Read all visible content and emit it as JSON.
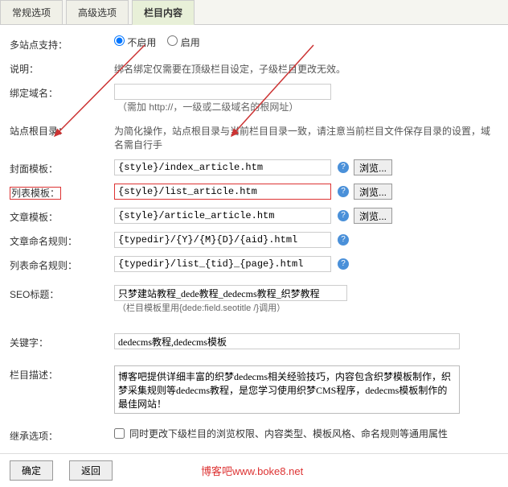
{
  "tabs": {
    "t1": "常规选项",
    "t2": "高级选项",
    "t3": "栏目内容"
  },
  "multisite": {
    "label": "多站点支持：",
    "off": "不启用",
    "on": "启用"
  },
  "explain": {
    "label": "说明：",
    "text": "绑名绑定仅需要在顶级栏目设定，子级栏目更改无效。"
  },
  "binddomain": {
    "label": "绑定域名：",
    "hint": "（需加 http://，一级或二级域名的根网址）"
  },
  "siteroot": {
    "label": "站点根目录：",
    "text": "为简化操作，站点根目录与当前栏目目录一致，请注意当前栏目文件保存目录的设置，域名需自行手"
  },
  "cover": {
    "label": "封面模板：",
    "value": "{style}/index_article.htm",
    "btn": "浏览..."
  },
  "list": {
    "label": "列表模板：",
    "value": "{style}/list_article.htm",
    "btn": "浏览..."
  },
  "article": {
    "label": "文章模板：",
    "value": "{style}/article_article.htm",
    "btn": "浏览..."
  },
  "artrule": {
    "label": "文章命名规则：",
    "value": "{typedir}/{Y}/{M}{D}/{aid}.html"
  },
  "listrule": {
    "label": "列表命名规则：",
    "value": "{typedir}/list_{tid}_{page}.html"
  },
  "seo": {
    "label": "SEO标题：",
    "value": "只梦建站教程_dede教程_dedecms教程_织梦教程",
    "hint": "（栏目模板里用{dede:field.seotitle /}调用）"
  },
  "keywords": {
    "label": "关键字：",
    "value": "dedecms教程,dedecms模板"
  },
  "desc": {
    "label": "栏目描述：",
    "value": "博客吧提供详细丰富的织梦dedecms相关经验技巧，内容包含织梦模板制作，织梦采集规则等dedecms教程，是您学习使用织梦CMS程序，dedecms模板制作的最佳网站！"
  },
  "inherit": {
    "label": "继承选项：",
    "text": "同时更改下级栏目的浏览权限、内容类型、模板风格、命名规则等通用属性"
  },
  "footer": {
    "ok": "确定",
    "back": "返回",
    "watermark": "博客吧www.boke8.net"
  }
}
